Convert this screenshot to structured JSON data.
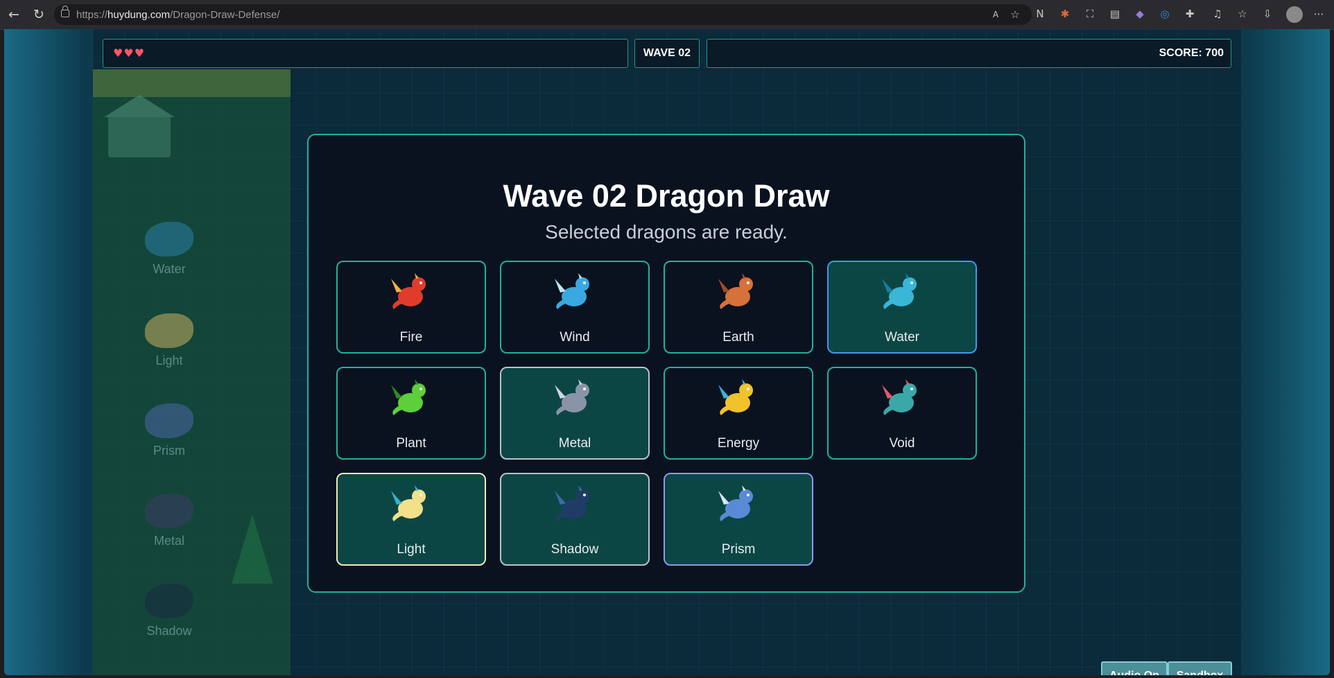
{
  "browser": {
    "url_prefix": "https://",
    "url_host": "huydung.com",
    "url_path": "/Dragon-Draw-Defense/"
  },
  "hud": {
    "hearts": "♥♥♥",
    "wave": "WAVE 02",
    "score": "SCORE: 700"
  },
  "sidebar": {
    "items": [
      {
        "label": "Water",
        "color": "#2b7fa8"
      },
      {
        "label": "Light",
        "color": "#c8b060"
      },
      {
        "label": "Prism",
        "color": "#4a66a8"
      },
      {
        "label": "Metal",
        "color": "#3c3c66"
      },
      {
        "label": "Shadow",
        "color": "#1a2a44"
      }
    ]
  },
  "modal": {
    "title": "Wave 02 Dragon Draw",
    "subtitle": "Selected dragons are ready.",
    "cards": [
      {
        "label": "Fire",
        "selected": false,
        "color": "#e03c2c",
        "accent": "#f2b33a"
      },
      {
        "label": "Wind",
        "selected": false,
        "color": "#3aa8e0",
        "accent": "#bfe6f7"
      },
      {
        "label": "Earth",
        "selected": false,
        "color": "#d6713a",
        "accent": "#a84a22"
      },
      {
        "label": "Water",
        "selected": true,
        "color": "#3ab6d6",
        "accent": "#1a7fa0"
      },
      {
        "label": "Plant",
        "selected": false,
        "color": "#5ccf3a",
        "accent": "#2a8a22"
      },
      {
        "label": "Metal",
        "selected": true,
        "color": "#8a94a8",
        "accent": "#cfd6e0"
      },
      {
        "label": "Energy",
        "selected": false,
        "color": "#f2c22a",
        "accent": "#3ab0e0"
      },
      {
        "label": "Void",
        "selected": false,
        "color": "#3aa8a8",
        "accent": "#e05a6a"
      },
      {
        "label": "Light",
        "selected": true,
        "color": "#f2e08a",
        "accent": "#3ab0d0"
      },
      {
        "label": "Shadow",
        "selected": true,
        "color": "#1f3c66",
        "accent": "#3a6aa8"
      },
      {
        "label": "Prism",
        "selected": true,
        "color": "#5a8ad6",
        "accent": "#d6e6f7"
      }
    ]
  },
  "buttons": {
    "audio": "Audio On",
    "sandbox": "Sandbox"
  }
}
